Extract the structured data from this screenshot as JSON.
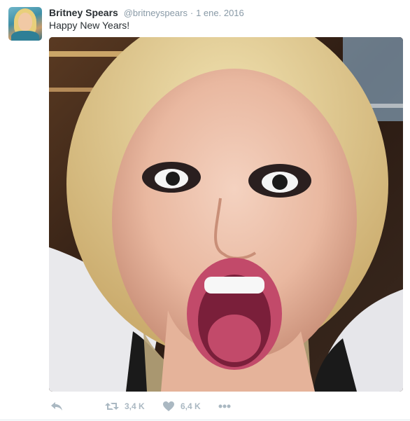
{
  "tweet": {
    "author_name": "Britney Spears",
    "author_handle": "@britneyspears",
    "separator": "·",
    "timestamp": "1 ene. 2016",
    "text": "Happy New Years!",
    "retweet_count": "3,4 K",
    "like_count": "6,4 K"
  },
  "icons": {
    "avatar": "avatar",
    "reply": "reply-icon",
    "retweet": "retweet-icon",
    "like": "heart-icon",
    "more": "more-dots-icon"
  },
  "colors": {
    "name": "#292f33",
    "meta": "#8899a6",
    "action": "#aab8c2",
    "divider": "#e1e8ed"
  }
}
